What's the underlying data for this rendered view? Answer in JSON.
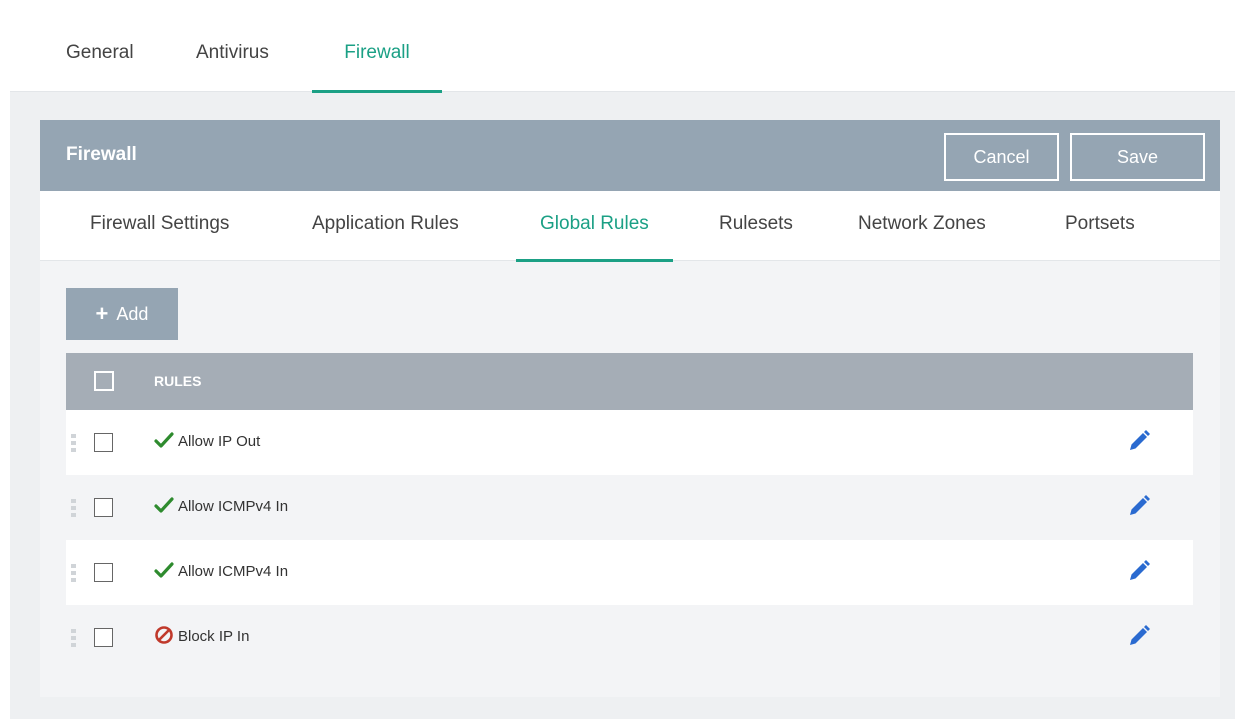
{
  "top_tabs": [
    {
      "label": "General",
      "active": false
    },
    {
      "label": "Antivirus",
      "active": false
    },
    {
      "label": "Firewall",
      "active": true
    }
  ],
  "panel": {
    "title": "Firewall",
    "cancel_label": "Cancel",
    "save_label": "Save"
  },
  "sub_tabs": [
    {
      "label": "Firewall Settings",
      "active": false
    },
    {
      "label": "Application Rules",
      "active": false
    },
    {
      "label": "Global Rules",
      "active": true
    },
    {
      "label": "Rulesets",
      "active": false
    },
    {
      "label": "Network Zones",
      "active": false
    },
    {
      "label": "Portsets",
      "active": false
    }
  ],
  "add_label": "Add",
  "table": {
    "column_header": "RULES",
    "rows": [
      {
        "name": "Allow IP Out",
        "action": "allow",
        "icon": "check-icon"
      },
      {
        "name": "Allow ICMPv4 In",
        "action": "allow",
        "icon": "check-icon"
      },
      {
        "name": "Allow ICMPv4 In",
        "action": "allow",
        "icon": "check-icon"
      },
      {
        "name": "Block IP In",
        "action": "block",
        "icon": "block-icon"
      }
    ]
  },
  "colors": {
    "accent": "#1ba085",
    "header_bg": "#95a5b3",
    "allow": "#2e8b2e",
    "block": "#c0392b",
    "edit": "#2a6ad0"
  }
}
